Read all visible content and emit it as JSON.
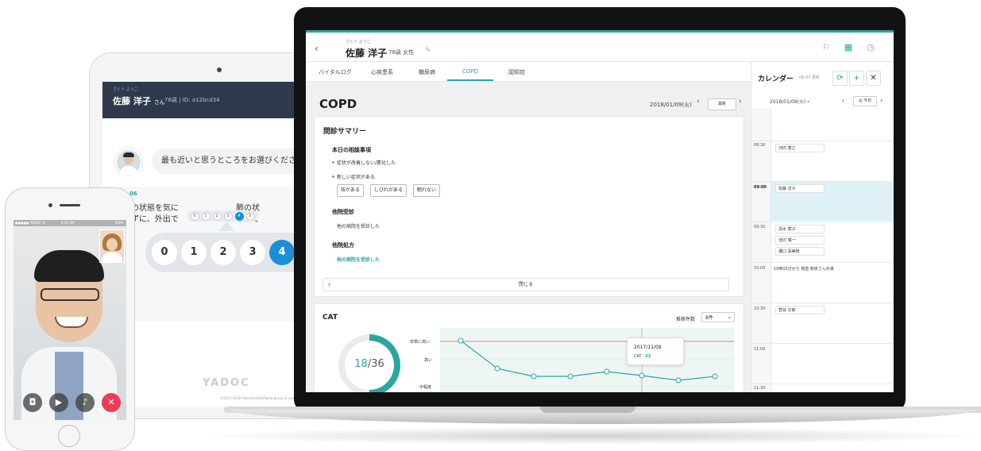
{
  "colors": {
    "accent": "#2aa6a0",
    "tablet_header": "#2e3a4b",
    "selected_blue": "#1990d5",
    "end_call": "#ec3b5a"
  },
  "tablet": {
    "patient_furigana": "さとう ようこ",
    "patient_name": "佐藤 洋子",
    "patient_suffix": "さん",
    "patient_age": "78歳",
    "patient_id": "ID: a12bcd34",
    "question_bubble": "最も近いと思うところをお選びください",
    "question_number": "06",
    "left_text_line1": "の状態を気に",
    "left_text_line2": "ずに、外出で",
    "right_text_line1": "肺の状",
    "right_text_line2": "なって",
    "mini_scale": [
      "0",
      "1",
      "2",
      "3",
      "4",
      "5"
    ],
    "scale": [
      "0",
      "1",
      "2",
      "3",
      "4",
      "5"
    ],
    "selected_value": "4",
    "logo": "YADOC",
    "copyright": "©2015-2018 ClaireSmith4kAlpha group of company"
  },
  "phone": {
    "status_carrier": "●●●●● YADOC 令",
    "status_time": "9:41 AM",
    "status_battery": "100%",
    "controls": [
      "camera-icon",
      "video-icon",
      "mic-icon",
      "end-call-icon"
    ]
  },
  "laptop": {
    "header": {
      "back": "‹",
      "patient_furigana": "さとう ようこ",
      "patient_name": "佐藤 洋子",
      "patient_age_sex": "78歳  女性",
      "edit_icon": "✎",
      "icons": [
        "flag-icon",
        "calendar-icon",
        "clock-icon"
      ]
    },
    "tabs": [
      "バイタルログ",
      "心疾患系",
      "糖尿病",
      "COPD",
      "認知症"
    ],
    "active_tab": "COPD",
    "main": {
      "title": "COPD",
      "date": "2018/01/09(火)",
      "latest_button": "最新"
    },
    "summary": {
      "heading": "問診サマリー",
      "consult_heading": "本日の相談事項",
      "consult_items": [
        "症状が改善しない/悪化した",
        "新しい症状がある"
      ],
      "symptom_chips": [
        "咳がある",
        "しびれがある",
        "眠れない"
      ],
      "other_hospital_heading": "他院受診",
      "other_hospital_text": "他の病院を受診した",
      "other_prescription_heading": "他院処方",
      "other_prescription_text": "他の病院を受診した",
      "close_button": "閉じる"
    },
    "cat": {
      "title": "CAT",
      "trend_label": "推移件数",
      "trend_value": "8件",
      "score": "18",
      "max": "/36",
      "y_labels": [
        "非常に高い",
        "高い",
        "中程度"
      ],
      "tooltip_date": "2017/11/09",
      "tooltip_label": "CAT : ",
      "tooltip_value": "22"
    },
    "calendar": {
      "title": "カレンダー",
      "updated": "08:43 更新",
      "date": "2018/01/09(火)",
      "today_button": "今日",
      "times": [
        "08:30",
        "09:00",
        "09:30",
        "10:00",
        "10:30",
        "11:00",
        "11:30"
      ],
      "events": {
        "e0830": "河内 寛之",
        "e0900": "佐藤 洋子",
        "e0930a": "清水 寛子",
        "e0930b": "池辺 慎一",
        "e0930c": "瀬口 喜美枝",
        "e1000": "10時15分から 検査 和泉さん外来",
        "e1030": "菅谷 次郎"
      }
    }
  }
}
